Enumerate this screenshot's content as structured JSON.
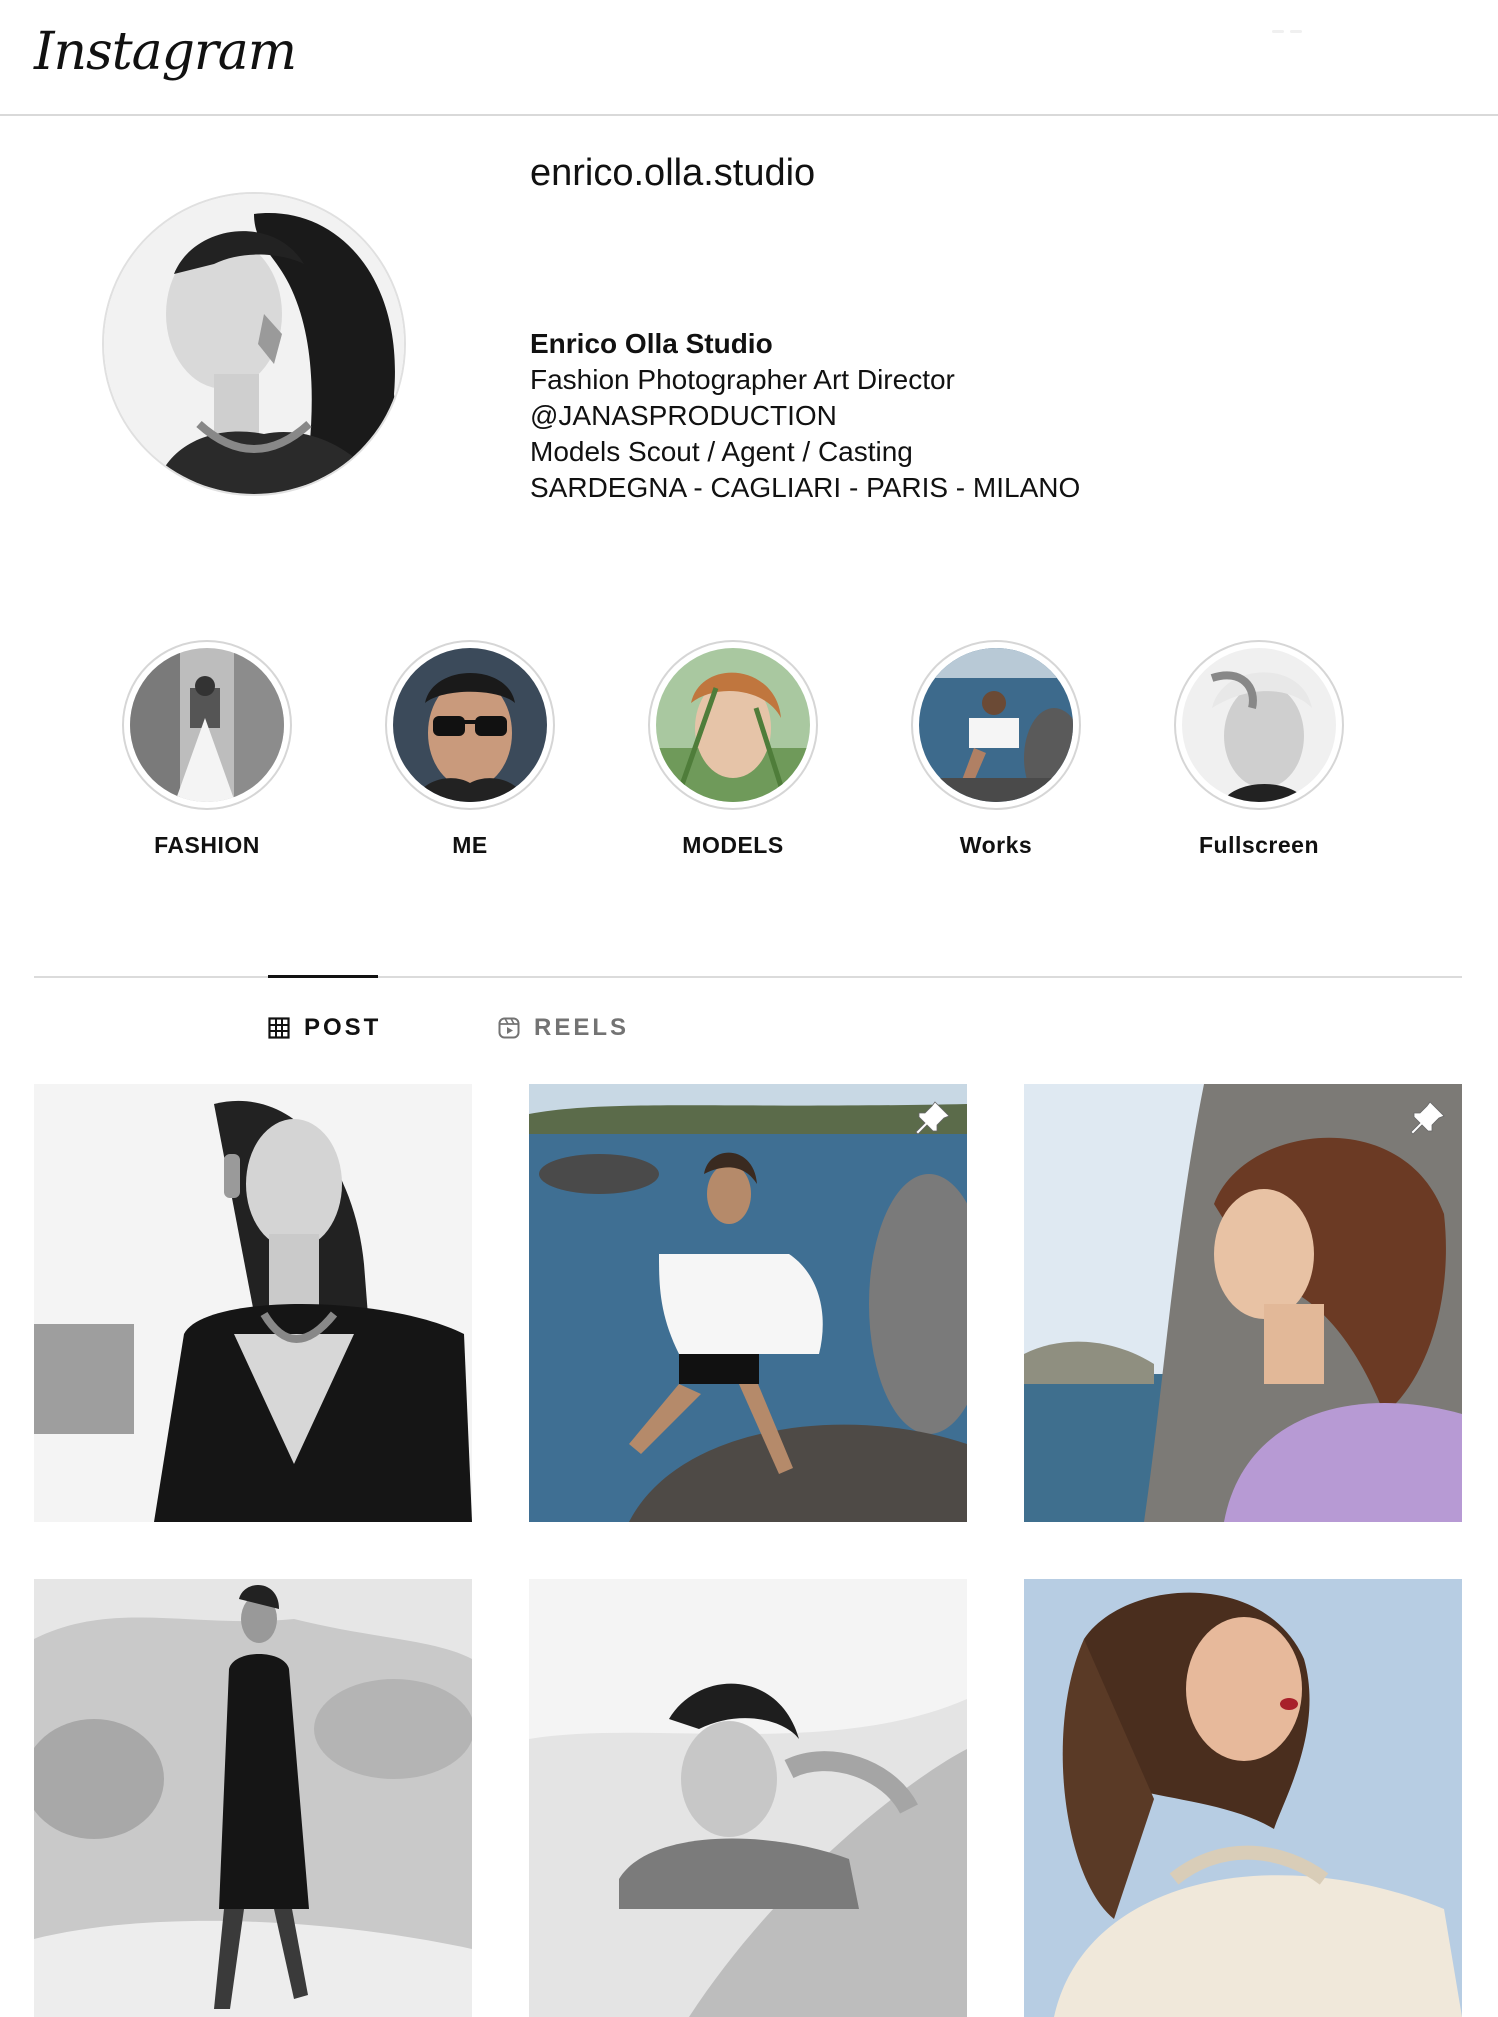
{
  "app": {
    "logo_text": "Instagram"
  },
  "profile": {
    "username": "enrico.olla.studio",
    "display_name": "Enrico Olla Studio",
    "bio_lines": [
      "Fashion Photographer Art Director",
      "@JANASPRODUCTION",
      "Models Scout / Agent / Casting",
      "SARDEGNA - CAGLIARI - PARIS - MILANO"
    ]
  },
  "highlights": [
    {
      "label": "FASHION"
    },
    {
      "label": "ME"
    },
    {
      "label": "MODELS"
    },
    {
      "label": "Works"
    },
    {
      "label": "Fullscreen"
    }
  ],
  "tabs": [
    {
      "label": "POST",
      "icon": "grid-icon",
      "active": true
    },
    {
      "label": "REELS",
      "icon": "reels-icon",
      "active": false
    }
  ],
  "posts": [
    {
      "description": "bw-portrait-necklace",
      "pinned": false
    },
    {
      "description": "model-white-top-sea-rocks",
      "pinned": true
    },
    {
      "description": "model-profile-purple-dress-sea",
      "pinned": true
    },
    {
      "description": "bw-model-black-dress-rocks",
      "pinned": false
    },
    {
      "description": "bw-model-lying-on-rock",
      "pinned": false
    },
    {
      "description": "model-cream-sweater-sky",
      "pinned": false
    }
  ],
  "colors": {
    "accent": "#111111",
    "muted": "#737373",
    "divider": "#dbdbdb"
  }
}
